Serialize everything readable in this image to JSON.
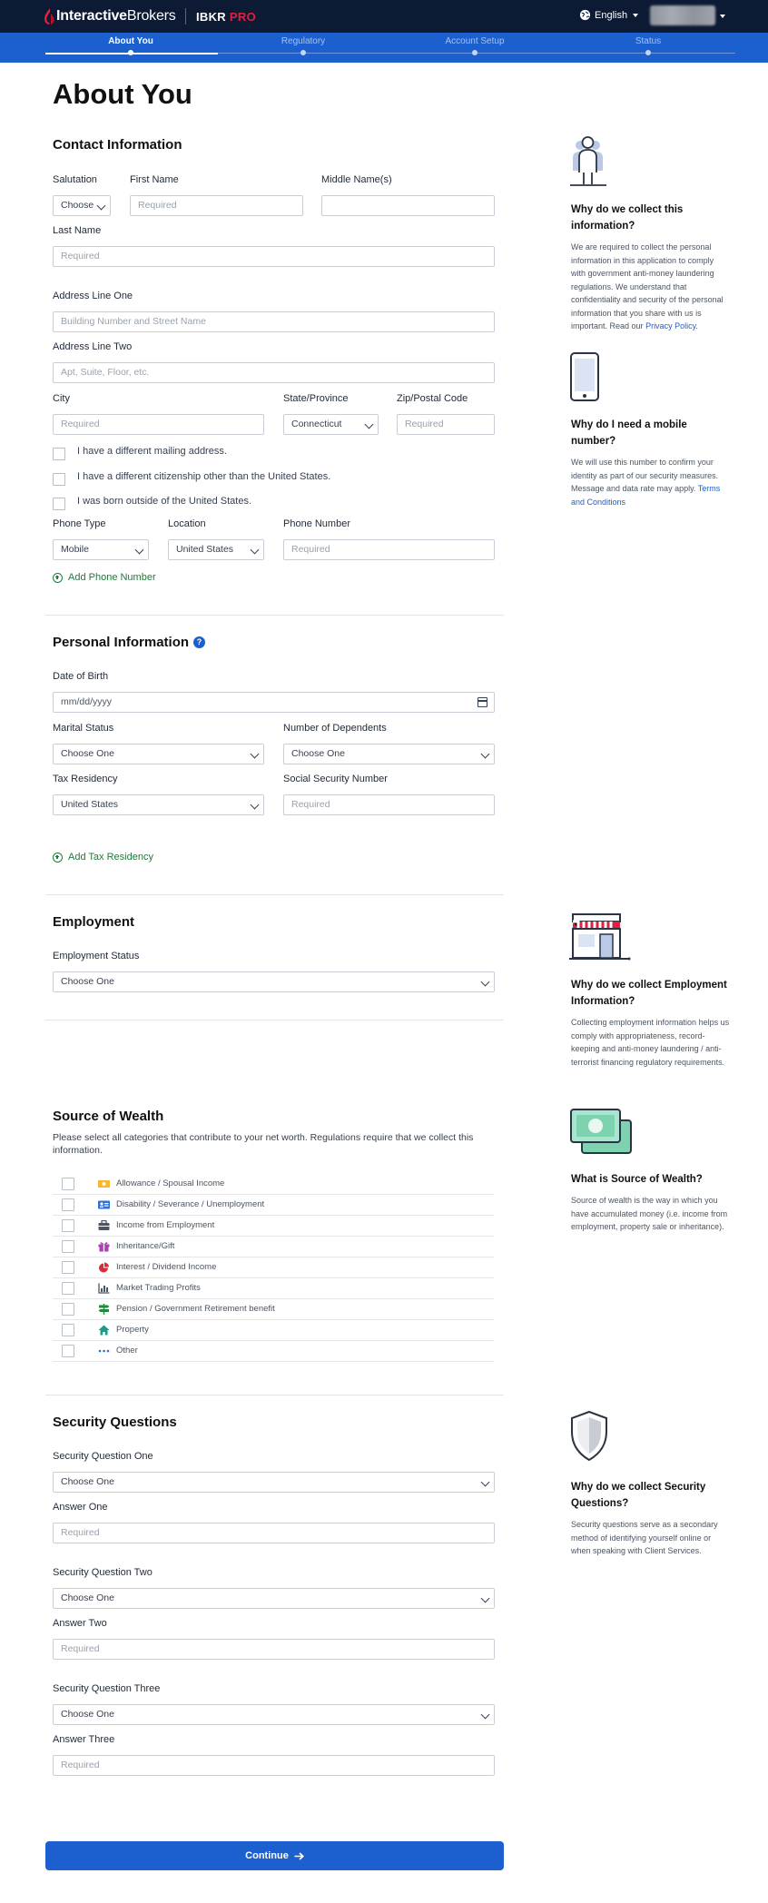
{
  "header": {
    "logo_bold": "Interactive",
    "logo_light": "Brokers",
    "product": "IBKR",
    "product_accent": "PRO",
    "language": "English"
  },
  "steps": [
    {
      "label": "About You",
      "active": true
    },
    {
      "label": "Regulatory",
      "active": false
    },
    {
      "label": "Account Setup",
      "active": false
    },
    {
      "label": "Status",
      "active": false
    }
  ],
  "page_title": "About You",
  "contact": {
    "title": "Contact Information",
    "salutation_label": "Salutation",
    "salutation_value": "Choose",
    "first_name_label": "First Name",
    "first_name_placeholder": "Required",
    "middle_name_label": "Middle Name(s)",
    "last_name_label": "Last Name",
    "last_name_placeholder": "Required",
    "address1_label": "Address Line One",
    "address1_placeholder": "Building Number and Street Name",
    "address2_label": "Address Line Two",
    "address2_placeholder": "Apt, Suite, Floor, etc.",
    "city_label": "City",
    "city_placeholder": "Required",
    "state_label": "State/Province",
    "state_value": "Connecticut",
    "zip_label": "Zip/Postal Code",
    "zip_placeholder": "Required",
    "checkbox_mailing": "I have a different mailing address.",
    "checkbox_citizenship": "I have a different citizenship other than the United States.",
    "checkbox_born": "I was born outside of the United States.",
    "phone_type_label": "Phone Type",
    "phone_type_value": "Mobile",
    "location_label": "Location",
    "location_value": "United States",
    "phone_number_label": "Phone Number",
    "phone_number_placeholder": "Required",
    "add_phone": "Add Phone Number"
  },
  "personal": {
    "title": "Personal Information",
    "help_glyph": "?",
    "dob_label": "Date of Birth",
    "dob_placeholder": "mm/dd/yyyy",
    "marital_label": "Marital Status",
    "marital_value": "Choose One",
    "dependents_label": "Number of Dependents",
    "dependents_value": "Choose One",
    "tax_label": "Tax Residency",
    "tax_value": "United States",
    "ssn_label": "Social Security Number",
    "ssn_placeholder": "Required",
    "add_tax": "Add Tax Residency"
  },
  "employment": {
    "title": "Employment",
    "status_label": "Employment Status",
    "status_value": "Choose One"
  },
  "wealth": {
    "title": "Source of Wealth",
    "description": "Please select all categories that contribute to your net worth. Regulations require that we collect this information.",
    "items": [
      {
        "label": "Allowance / Spousal Income",
        "icon": "cash-icon",
        "color": "#f5b82e"
      },
      {
        "label": "Disability / Severance / Unemployment",
        "icon": "id-card-icon",
        "color": "#2f6fd6"
      },
      {
        "label": "Income from Employment",
        "icon": "briefcase-icon",
        "color": "#4b5563"
      },
      {
        "label": "Inheritance/Gift",
        "icon": "gift-icon",
        "color": "#b03bbd"
      },
      {
        "label": "Interest / Dividend Income",
        "icon": "pie-chart-icon",
        "color": "#d92b3a"
      },
      {
        "label": "Market Trading Profits",
        "icon": "bar-chart-icon",
        "color": "#4b5563"
      },
      {
        "label": "Pension / Government Retirement benefit",
        "icon": "signpost-icon",
        "color": "#1f8a3b"
      },
      {
        "label": "Property",
        "icon": "house-icon",
        "color": "#1f9a8a"
      },
      {
        "label": "Other",
        "icon": "dots-icon",
        "color": "#2f6fd6"
      }
    ]
  },
  "security": {
    "title": "Security Questions",
    "q1_label": "Security Question One",
    "q1_value": "Choose One",
    "a1_label": "Answer One",
    "a1_placeholder": "Required",
    "q2_label": "Security Question Two",
    "q2_value": "Choose One",
    "a2_label": "Answer Two",
    "a2_placeholder": "Required",
    "q3_label": "Security Question Three",
    "q3_value": "Choose One",
    "a3_label": "Answer Three",
    "a3_placeholder": "Required"
  },
  "side": {
    "why_collect_title": "Why do we collect this information?",
    "why_collect_text": "We are required to collect the personal information in this application to comply with government anti-money laundering regulations. We understand that confidentiality and security of the personal information that you share with us is important. Read our",
    "privacy_link": "Privacy Policy",
    "mobile_title": "Why do I need a mobile number?",
    "mobile_text": "We will use this number to confirm your identity as part of our security measures. Message and data rate may apply.",
    "terms_link": "Terms and Conditions",
    "employment_title": "Why do we collect Employment Information?",
    "employment_text": "Collecting employment information helps us comply with appropriateness, record-keeping and anti-money laundering / anti-terrorist financing regulatory requirements.",
    "wealth_title": "What is Source of Wealth?",
    "wealth_text": "Source of wealth is the way in which you have accumulated money (i.e. income from employment, property sale or inheritance).",
    "security_title": "Why do we collect Security Questions?",
    "security_text": "Security questions serve as a secondary method of identifying yourself online or when speaking with Client Services."
  },
  "continue_label": "Continue",
  "colors": {
    "brand_blue": "#1c5fcf",
    "header_navy": "#0c1a33",
    "accent_red": "#e0203f",
    "link_green": "#1f7a3a"
  }
}
